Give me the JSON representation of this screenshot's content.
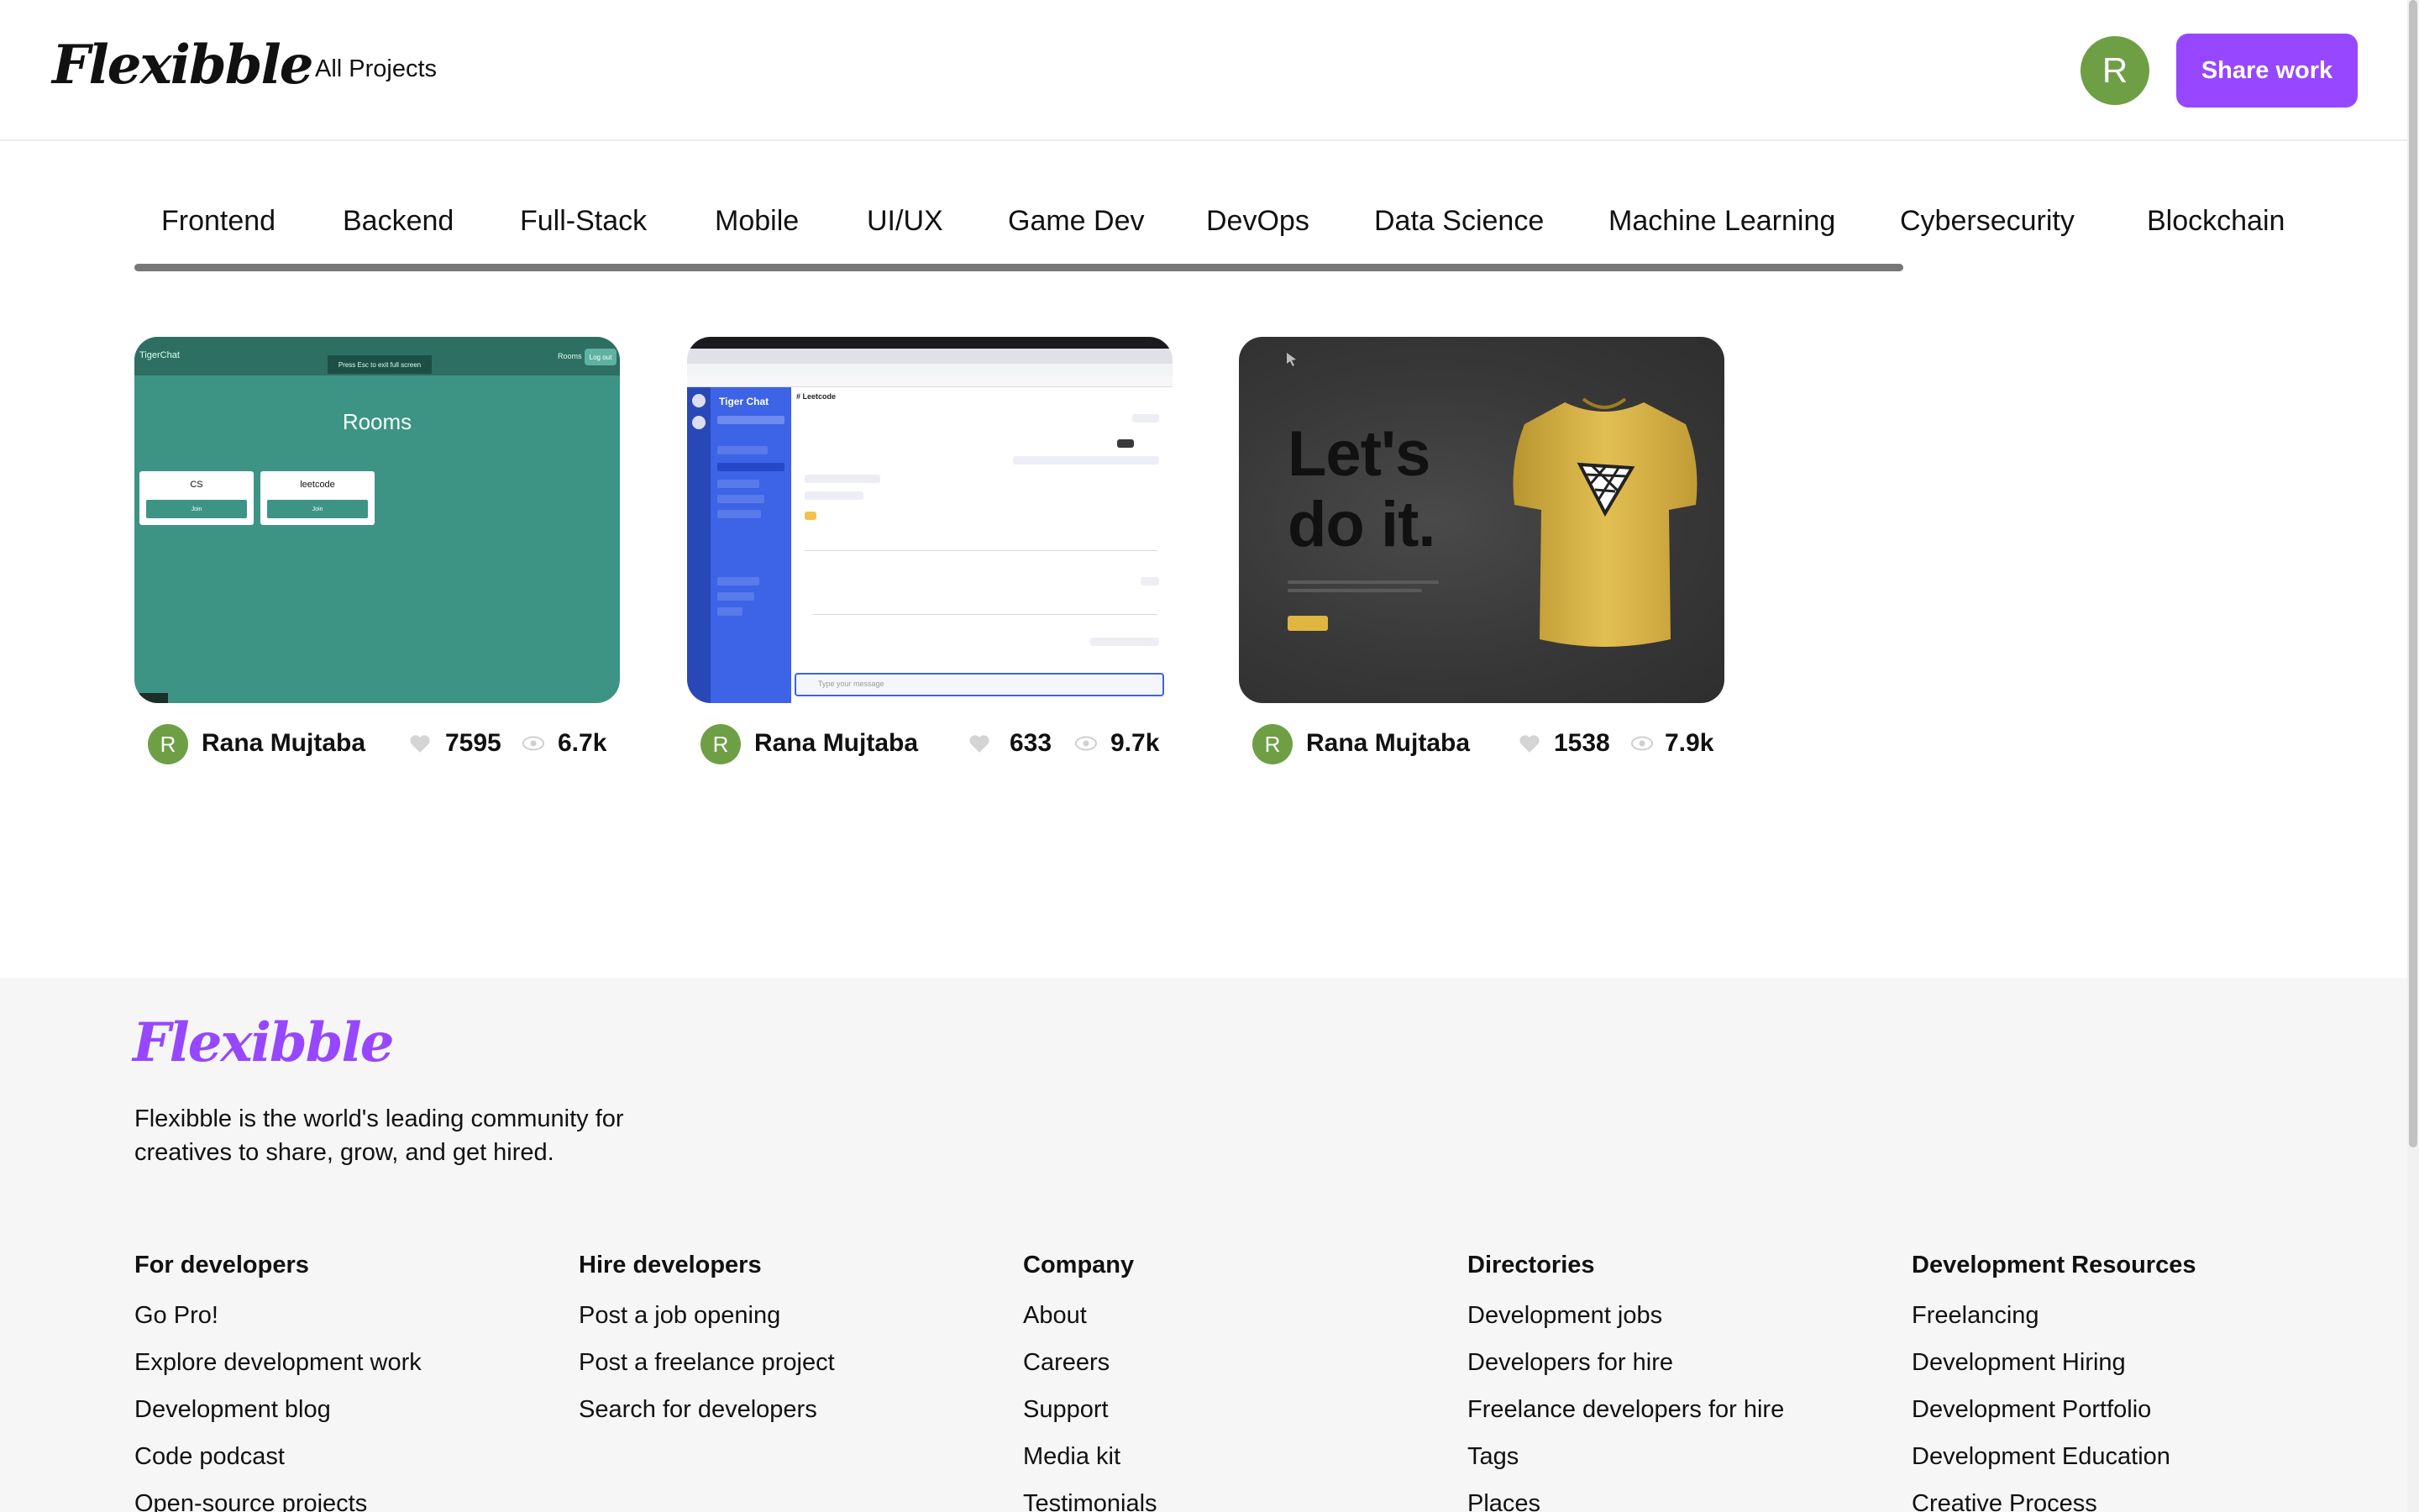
{
  "header": {
    "logo": "Flexibble",
    "nav_all_projects": "All Projects",
    "avatar_initial": "R",
    "share_button": "Share work"
  },
  "categories": [
    "Frontend",
    "Backend",
    "Full-Stack",
    "Mobile",
    "UI/UX",
    "Game Dev",
    "DevOps",
    "Data Science",
    "Machine Learning",
    "Cybersecurity",
    "Blockchain"
  ],
  "projects": [
    {
      "author_initial": "R",
      "author": "Rana Mujtaba",
      "likes": "7595",
      "views": "6.7k",
      "thumb": {
        "app_label": "TigerChat",
        "fullscreen_hint": "Press Esc to exit full screen",
        "nav_rooms": "Rooms",
        "logout": "Log out",
        "heading": "Rooms",
        "rooms": [
          {
            "name": "CS",
            "button": "Join"
          },
          {
            "name": "leetcode",
            "button": "Join"
          }
        ]
      }
    },
    {
      "author_initial": "R",
      "author": "Rana Mujtaba",
      "likes": "633",
      "views": "9.7k",
      "thumb": {
        "sidebar_title": "Tiger Chat",
        "channel": "# Leetcode",
        "input_placeholder": "Type your message"
      }
    },
    {
      "author_initial": "R",
      "author": "Rana Mujtaba",
      "likes": "1538",
      "views": "7.9k",
      "thumb": {
        "slogan_line1": "Let's",
        "slogan_line2": "do it."
      }
    }
  ],
  "footer": {
    "logo": "Flexibble",
    "description": "Flexibble is the world's leading community for creatives to share, grow, and get hired.",
    "columns": [
      {
        "title": "For developers",
        "links": [
          "Go Pro!",
          "Explore development work",
          "Development blog",
          "Code podcast",
          "Open-source projects"
        ]
      },
      {
        "title": "Hire developers",
        "links": [
          "Post a job opening",
          "Post a freelance project",
          "Search for developers"
        ]
      },
      {
        "title": "Company",
        "links": [
          "About",
          "Careers",
          "Support",
          "Media kit",
          "Testimonials"
        ]
      },
      {
        "title": "Directories",
        "links": [
          "Development jobs",
          "Developers for hire",
          "Freelance developers for hire",
          "Tags",
          "Places"
        ]
      },
      {
        "title": "Development Resources",
        "links": [
          "Freelancing",
          "Development Hiring",
          "Development Portfolio",
          "Development Education",
          "Creative Process"
        ]
      }
    ]
  },
  "colors": {
    "accent": "#9747ff",
    "avatar": "#6e9f45",
    "footer_bg": "#f6f6f6"
  }
}
